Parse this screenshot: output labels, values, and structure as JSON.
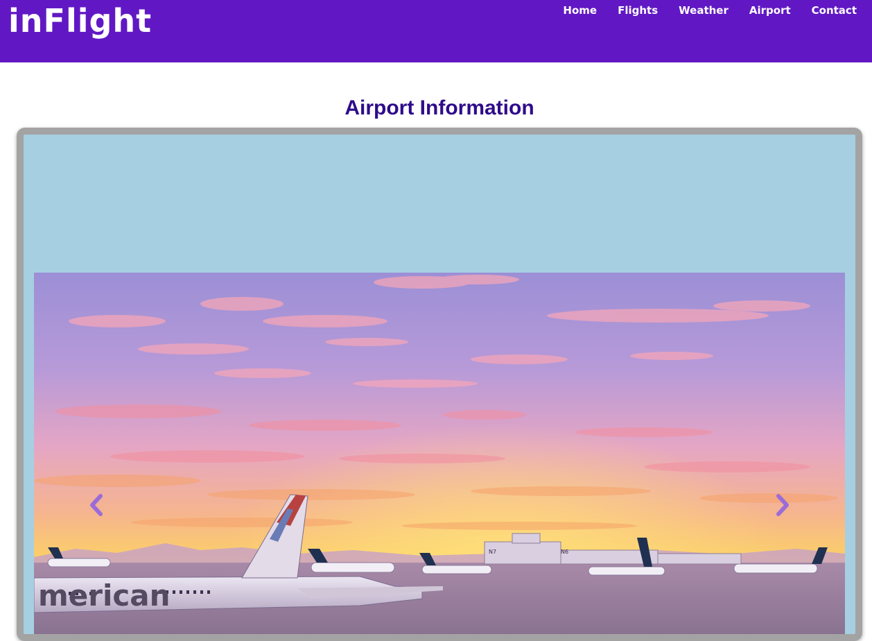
{
  "navbar": {
    "brand": "inFlight",
    "links": [
      "Home",
      "Flights",
      "Weather",
      "Airport",
      "Contact"
    ]
  },
  "page": {
    "title": "Airport Information"
  },
  "carousel": {
    "prev_icon": "chevron-left-icon",
    "next_icon": "chevron-right-icon",
    "image_text": {
      "fuselage_livery": "merican",
      "gate_n7": "N7",
      "gate_n6": "N6"
    }
  },
  "colors": {
    "navbar": "#6118c4",
    "title": "#2e0b8a",
    "panel_background": "#a6cfe2",
    "panel_border": "#a3a3a3",
    "arrow": "#9b6cd8"
  }
}
